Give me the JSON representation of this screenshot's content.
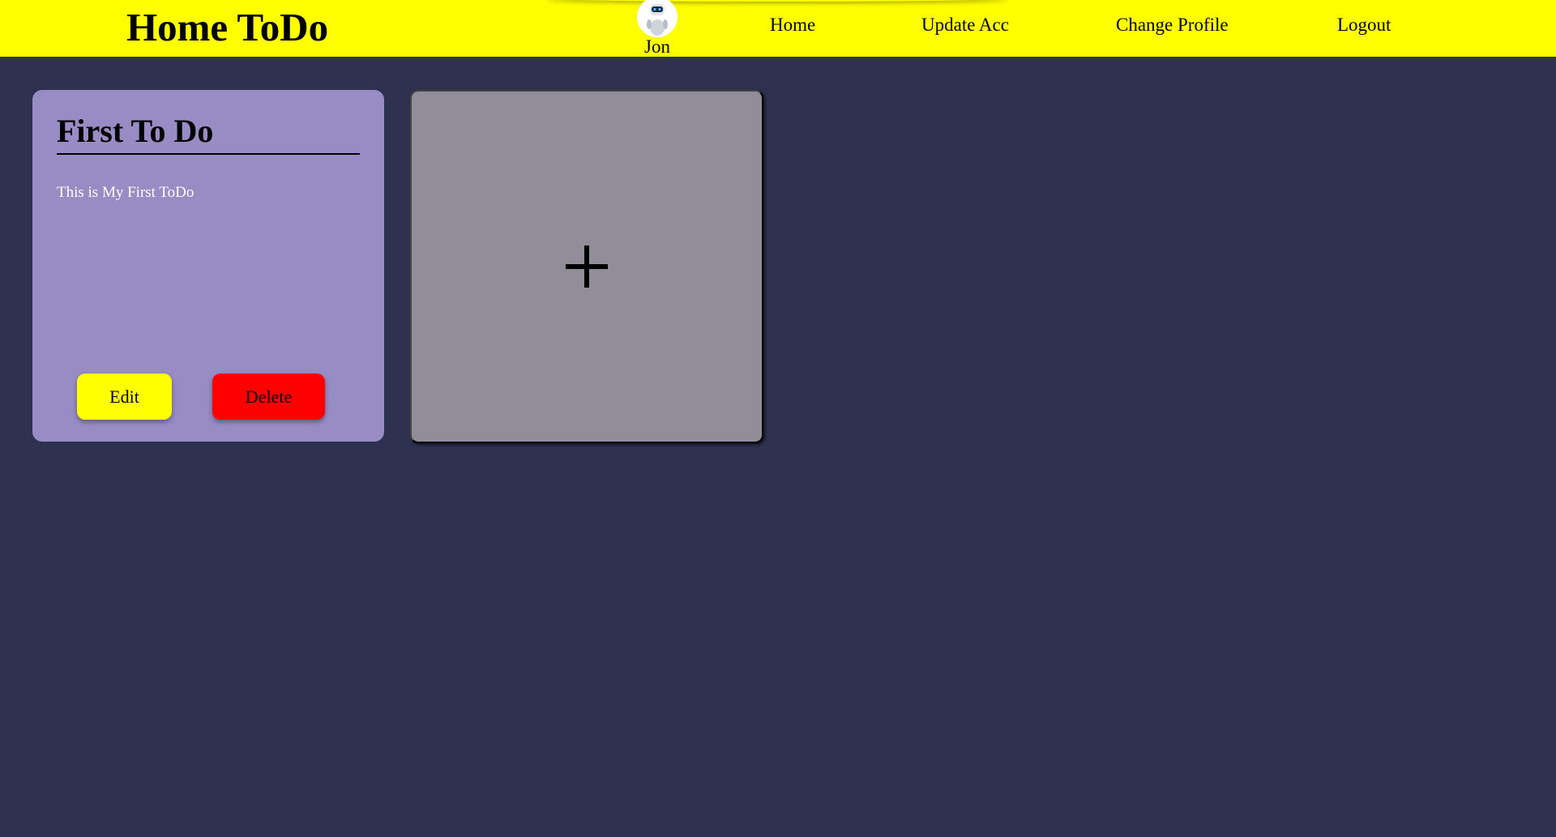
{
  "navbar": {
    "brand": "Home ToDo",
    "user_name": "Jon",
    "avatar_icon": "robot-avatar-icon",
    "links": [
      "Home",
      "Update Acc",
      "Change Profile",
      "Logout"
    ],
    "bg_color": "#ffff00"
  },
  "todos": [
    {
      "title": "First To Do",
      "description": "This is My First ToDo",
      "edit_label": "Edit",
      "delete_label": "Delete"
    }
  ],
  "add_card": {
    "icon": "plus-icon"
  },
  "colors": {
    "page_bg": "#2e3150",
    "card_bg": "#978cc4",
    "add_card_bg": "#918e9a",
    "edit_button": "#ffff00",
    "delete_button": "#ff0000"
  }
}
